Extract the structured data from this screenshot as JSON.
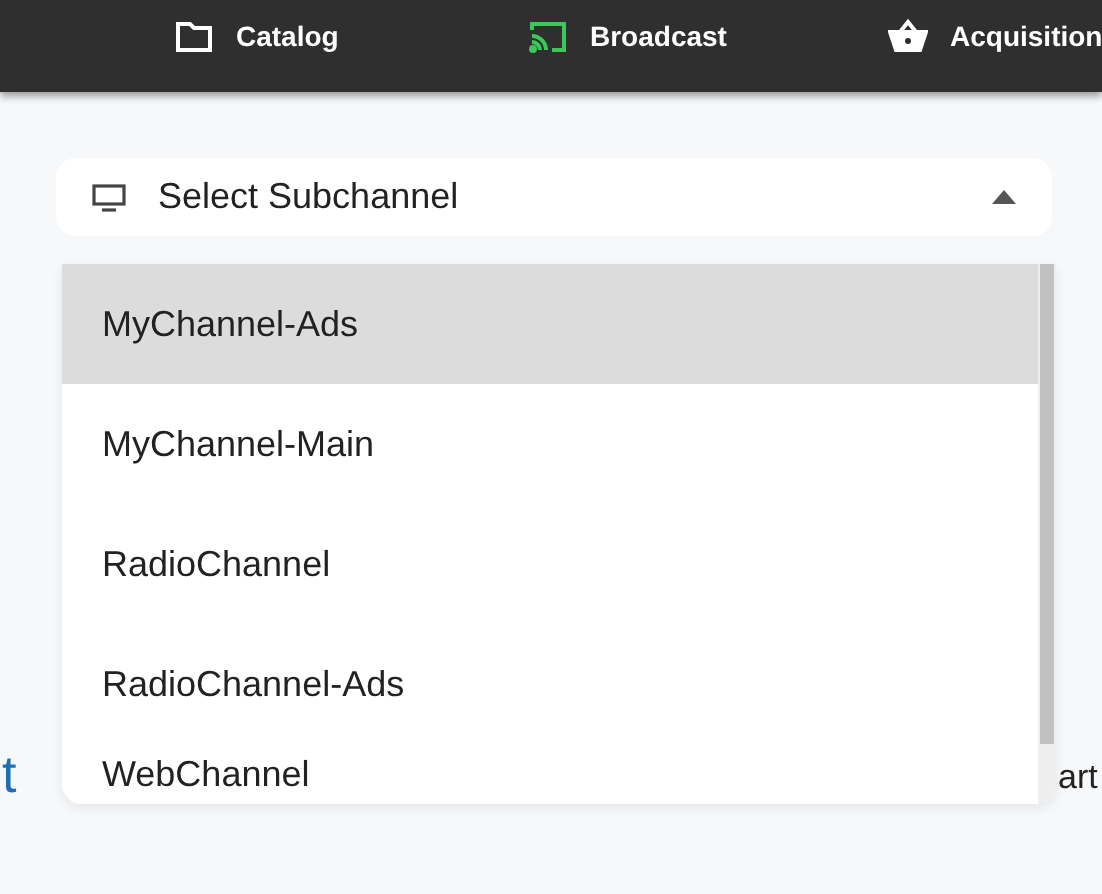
{
  "nav": {
    "items": [
      {
        "label": "Catalog",
        "kind": "folder",
        "selected": false
      },
      {
        "label": "Broadcast",
        "kind": "cast",
        "selected": true
      },
      {
        "label": "Acquisition",
        "kind": "basket",
        "selected": false
      }
    ]
  },
  "select": {
    "placeholder": "Select Subchannel",
    "expanded": true
  },
  "options": [
    {
      "label": "MyChannel-Ads",
      "selected": true
    },
    {
      "label": "MyChannel-Main",
      "selected": false
    },
    {
      "label": "RadioChannel",
      "selected": false
    },
    {
      "label": "RadioChannel-Ads",
      "selected": false
    },
    {
      "label": "WebChannel",
      "selected": false
    }
  ],
  "background_texts": [
    "t",
    "art"
  ]
}
